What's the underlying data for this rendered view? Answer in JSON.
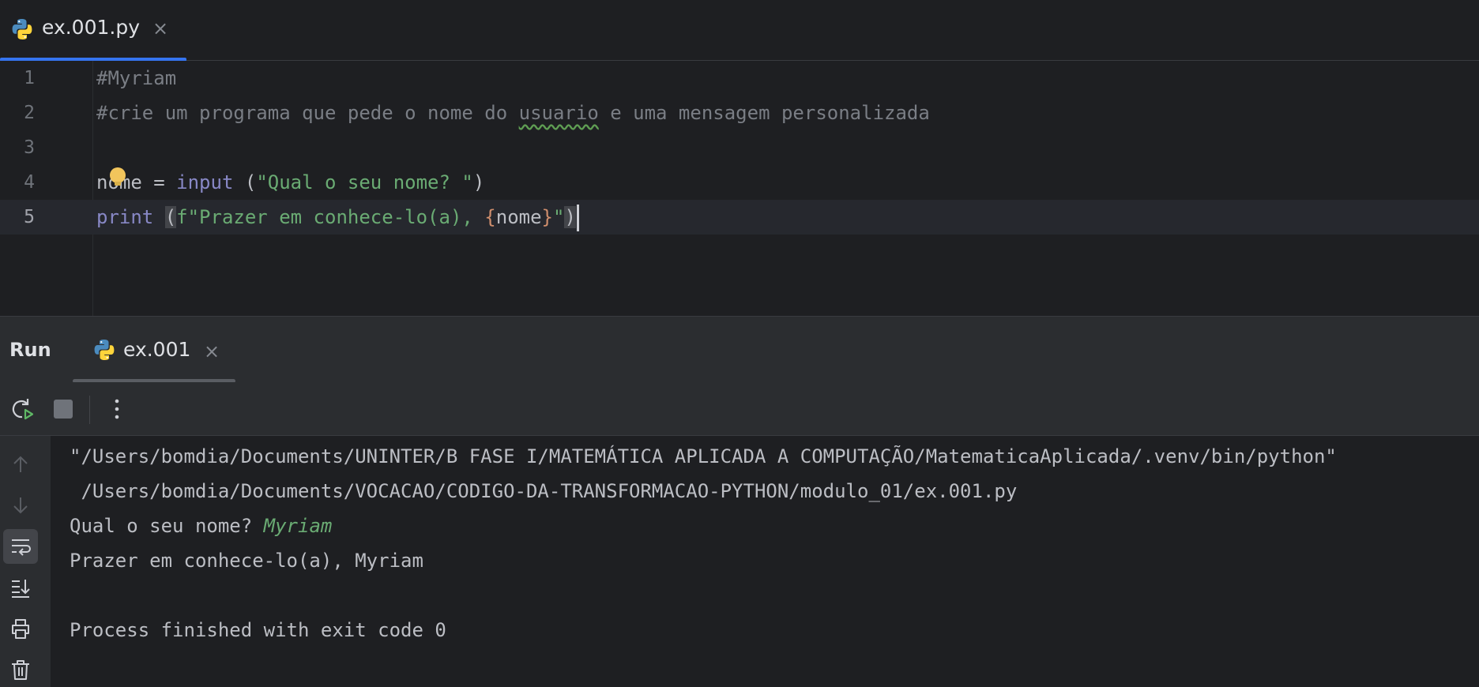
{
  "editor": {
    "tab": {
      "label": "ex.001.py",
      "icon": "python-icon",
      "close": "×"
    },
    "lines": [
      {
        "number": "1",
        "text": "#Myriam"
      },
      {
        "number": "2",
        "pre": "#crie um programa que pede o nome do ",
        "typo": "usuario",
        "post": " e uma mensagem personalizada"
      },
      {
        "number": "3",
        "text": ""
      },
      {
        "number": "4",
        "var": "nome",
        "eq": " = ",
        "fn": "input",
        "sp": " (",
        "str": "\"Qual o seu nome? \"",
        "close": ")"
      },
      {
        "number": "5",
        "fn": "print",
        "sp": " ",
        "paren": "(",
        "str1": "f\"Prazer em conhece-lo(a), ",
        "brace_open": "{",
        "var": "nome",
        "brace_close": "}",
        "str2": "\"",
        "close": ")"
      }
    ],
    "current_line": 5,
    "intention_icon": "lightbulb-icon"
  },
  "run": {
    "title": "Run",
    "tab": {
      "label": "ex.001",
      "icon": "python-icon",
      "close": "×"
    },
    "toolbar": [
      "rerun-icon",
      "stop-icon",
      "more-options-icon"
    ],
    "side_actions": [
      "scroll-up-icon",
      "scroll-down-icon",
      "soft-wrap-icon",
      "scroll-to-end-icon",
      "print-icon",
      "clear-icon"
    ],
    "output": {
      "cmd_line1": "\"/Users/bomdia/Documents/UNINTER/B FASE I/MATEMÁTICA APLICADA A COMPUTAÇÃO/MatematicaAplicada/.venv/bin/python\"",
      "cmd_line2": " /Users/bomdia/Documents/VOCACAO/CODIGO-DA-TRANSFORMACAO-PYTHON/modulo_01/ex.001.py",
      "prompt": "Qual o seu nome? ",
      "user_input": "Myriam",
      "response": "Prazer em conhece-lo(a), Myriam",
      "blank": "",
      "exit": "Process finished with exit code 0"
    }
  },
  "colors": {
    "background": "#1e1f22",
    "panel": "#2b2d30",
    "accent": "#3574f0",
    "keyword": "#8888c6",
    "string": "#6aab73",
    "comment": "#7a7e85",
    "brace": "#cf8e6d"
  }
}
